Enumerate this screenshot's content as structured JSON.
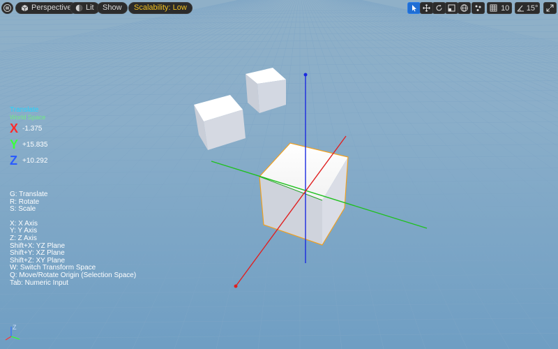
{
  "toolbar": {
    "menu_icon": "hamburger-icon",
    "perspective": {
      "label": "Perspective",
      "icon": "cube-icon"
    },
    "lit": {
      "label": "Lit",
      "icon": "lit-sphere-icon"
    },
    "show": {
      "label": "Show"
    },
    "scalability": {
      "label": "Scalability: Low",
      "color": "#f0c020"
    },
    "right_tools": [
      {
        "name": "select-tool-icon",
        "active": true
      },
      {
        "name": "translate-tool-icon",
        "active": false
      },
      {
        "name": "rotate-tool-icon",
        "active": false
      },
      {
        "name": "scale-tool-icon",
        "active": false
      },
      {
        "name": "world-space-icon",
        "active": false
      },
      {
        "name": "surface-snap-icon",
        "active": false
      }
    ],
    "grid_snap": {
      "icon": "grid-snap-icon",
      "value": "10"
    },
    "rotation_snap": {
      "icon": "angle-snap-icon",
      "value": "15°"
    },
    "maximize_icon": "maximize-icon"
  },
  "hud": {
    "mode": "Translate",
    "submode": "World Space",
    "x": {
      "letter": "X",
      "value": "-1.375",
      "color": "#ff2a2a"
    },
    "y": {
      "letter": "Y",
      "value": "+15.835",
      "color": "#3cff3c"
    },
    "z": {
      "letter": "Z",
      "value": "+10.292",
      "color": "#2a5cff"
    }
  },
  "shortcuts": {
    "group1": [
      "G: Translate",
      "R: Rotate",
      "S: Scale"
    ],
    "group2": [
      "X: X Axis",
      "Y: Y Axis",
      "Z: Z Axis",
      "Shift+X: YZ Plane",
      "Shift+Y: XZ Plane",
      "Shift+Z: XY Plane",
      "W: Switch Transform Space",
      "Q: Move/Rotate Origin (Selection Space)",
      "Tab: Numeric Input"
    ]
  },
  "corner_axes": {
    "z_label": "Z",
    "x_color": "#ff3030",
    "y_color": "#30ff30",
    "z_color": "#3070ff"
  },
  "colors": {
    "selection": "#f0a020",
    "gizmo_x": "#e02020",
    "gizmo_y": "#20d020",
    "gizmo_z": "#2020e0"
  }
}
